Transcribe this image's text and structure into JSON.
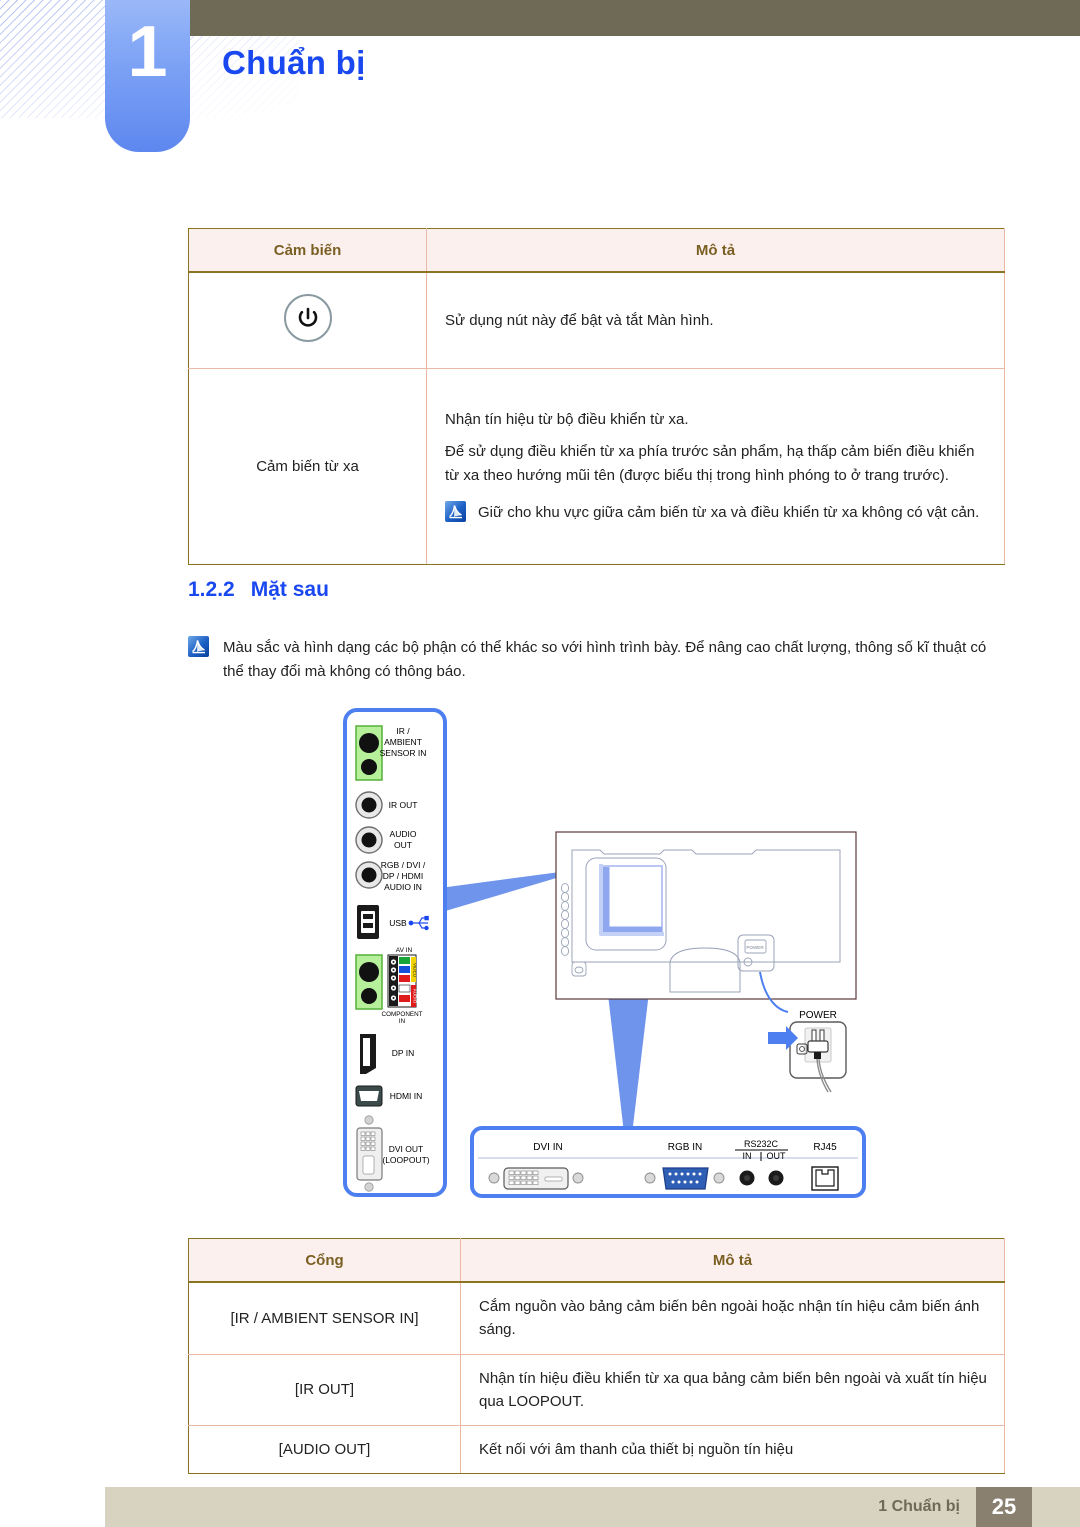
{
  "header": {
    "chapter_number": "1",
    "chapter_title": "Chuẩn bị"
  },
  "sensor_table": {
    "columns": [
      "Cảm biến",
      "Mô tả"
    ],
    "rows": [
      {
        "sensor_icon": "power-icon",
        "sensor_label": "",
        "description_paragraphs": [
          "Sử dụng nút này để bật và tắt Màn hình."
        ],
        "note": ""
      },
      {
        "sensor_icon": "",
        "sensor_label": "Cảm biến từ xa",
        "description_paragraphs": [
          "Nhận tín hiệu từ bộ điều khiển từ xa.",
          "Để sử dụng điều khiển từ xa phía trước sản phẩm, hạ thấp cảm biến điều khiển từ xa theo hướng mũi tên (được biểu thị trong hình phóng to ở trang trước)."
        ],
        "note": "Giữ cho khu vực giữa cảm biến từ xa và điều khiển từ xa không có vật cản."
      }
    ]
  },
  "section": {
    "number": "1.2.2",
    "title": "Mặt sau"
  },
  "page_note": {
    "icon": "note-icon",
    "text": "Màu sắc và hình dạng các bộ phận có thể khác so với hình trình bày. Để nâng cao chất lượng, thông số kĩ thuật có thể thay đổi mà không có thông báo."
  },
  "diagram": {
    "side_panel_ports": [
      {
        "id": "ir-ambient-sensor-in",
        "label": "IR /\nAMBIENT\nSENSOR IN"
      },
      {
        "id": "ir-out",
        "label": "IR OUT"
      },
      {
        "id": "audio-out",
        "label": "AUDIO\nOUT"
      },
      {
        "id": "rgb-dvi-dp-hdmi-audio-in",
        "label": "RGB / DVI /\nDP / HDMI\nAUDIO IN"
      },
      {
        "id": "usb",
        "label": "USB"
      },
      {
        "id": "av-in",
        "label": "AV IN"
      },
      {
        "id": "component-in",
        "label": "COMPONENT\nIN"
      },
      {
        "id": "video",
        "label": "VIDEO"
      },
      {
        "id": "audio",
        "label": "AUDIO"
      },
      {
        "id": "dp-in",
        "label": "DP IN"
      },
      {
        "id": "hdmi-in",
        "label": "HDMI IN"
      },
      {
        "id": "dvi-out-loopout",
        "label": "DVI OUT\n(LOOPOUT)"
      }
    ],
    "side_panel_labels": {
      "ir_ambient_1": "IR /",
      "ir_ambient_2": "AMBIENT",
      "ir_ambient_3": "SENSOR IN",
      "ir_out": "IR OUT",
      "audio_out_1": "AUDIO",
      "audio_out_2": "OUT",
      "rgb_1": "RGB / DVI /",
      "rgb_2": "DP / HDMI",
      "rgb_3": "AUDIO IN",
      "usb": "USB",
      "av_in": "AV IN",
      "video": "VIDEO",
      "audio": "AUDIO",
      "component_1": "COMPONENT",
      "component_2": "IN",
      "dp_in": "DP IN",
      "hdmi_in": "HDMI IN",
      "dvi_out_1": "DVI OUT",
      "dvi_out_2": "(LOOPOUT)"
    },
    "power_label": "POWER",
    "bottom_panel_labels": {
      "dvi_in": "DVI IN",
      "rgb_in": "RGB IN",
      "rs232c": "RS232C",
      "rs232c_in": "IN",
      "rs232c_out": "OUT",
      "rj45": "RJ45"
    }
  },
  "port_table": {
    "columns": [
      "Cổng",
      "Mô tả"
    ],
    "rows": [
      {
        "port": "[IR / AMBIENT SENSOR IN]",
        "description": "Cắm nguồn vào bảng cảm biến bên ngoài hoặc nhận tín hiệu cảm biến ánh sáng."
      },
      {
        "port": "[IR OUT]",
        "description": "Nhận tín hiệu điều khiển từ xa qua bảng cảm biến bên ngoài và xuất tín hiệu qua LOOPOUT."
      },
      {
        "port": "[AUDIO OUT]",
        "description": "Kết nối với âm thanh của thiết bị nguồn tín hiệu"
      }
    ]
  },
  "footer": {
    "label": "1 Chuẩn bị",
    "page_number": "25"
  },
  "colors": {
    "header_bar": "#6f6a55",
    "chapter_blue": "#7ba1f5",
    "title_blue": "#1a48f0",
    "table_header_bg": "#fcf0ee",
    "table_header_text": "#7a5f23",
    "table_border": "#e9b9a6",
    "table_border_strong": "#8a7321",
    "footer_bar": "#d8d3c0",
    "footer_page_bg": "#8a8070",
    "callout_blue": "#6f94ec"
  }
}
